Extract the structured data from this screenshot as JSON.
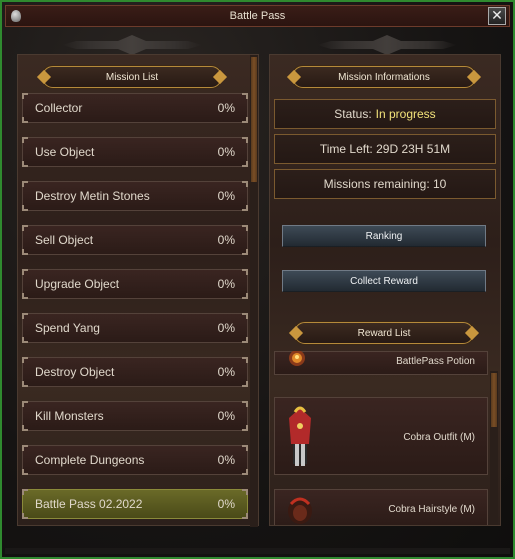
{
  "window": {
    "title": "Battle Pass",
    "close_label": "✕"
  },
  "mission_list": {
    "header": "Mission List",
    "items": [
      {
        "name": "Collector",
        "progress": "0%"
      },
      {
        "name": "Use Object",
        "progress": "0%"
      },
      {
        "name": "Destroy Metin Stones",
        "progress": "0%"
      },
      {
        "name": "Sell Object",
        "progress": "0%"
      },
      {
        "name": "Upgrade Object",
        "progress": "0%"
      },
      {
        "name": "Spend Yang",
        "progress": "0%"
      },
      {
        "name": "Destroy Object",
        "progress": "0%"
      },
      {
        "name": "Kill Monsters",
        "progress": "0%"
      },
      {
        "name": "Complete Dungeons",
        "progress": "0%"
      },
      {
        "name": "Battle Pass 02.2022",
        "progress": "0%",
        "selected": true
      }
    ]
  },
  "mission_info": {
    "header": "Mission Informations",
    "status_label": "Status:",
    "status_value": "In progress",
    "time_left": "Time Left: 29D 23H 51M",
    "missions_remaining": "Missions remaining: 10",
    "ranking_button": "Ranking",
    "collect_button": "Collect Reward"
  },
  "reward_list": {
    "header": "Reward List",
    "items": [
      {
        "name": "BattlePass Potion",
        "icon": "potion-icon"
      },
      {
        "name": "Cobra Outfit (M)",
        "icon": "outfit-icon"
      },
      {
        "name": "Cobra Hairstyle (M)",
        "icon": "hairstyle-icon"
      }
    ]
  },
  "colors": {
    "window_border": "#2f8a2f",
    "status_highlight": "#f2e27a",
    "header_border": "#b58a3a",
    "selected_item": "#6a6a28"
  }
}
